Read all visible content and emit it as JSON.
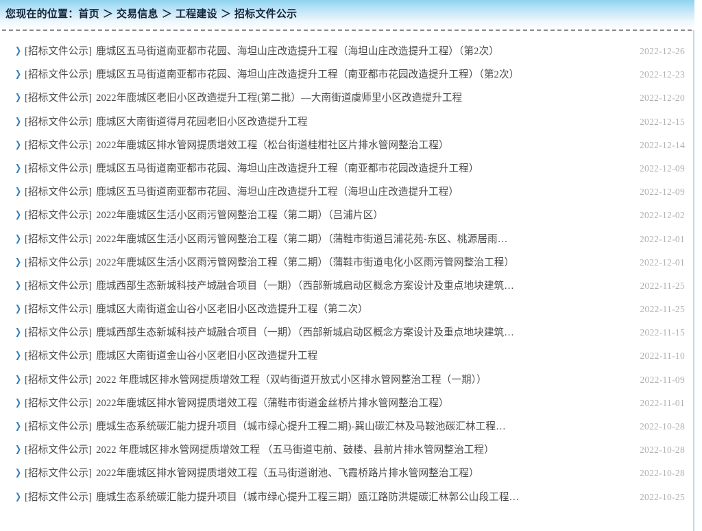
{
  "breadcrumb": {
    "label": "您现在的位置：",
    "separator": "＞",
    "items": [
      {
        "text": "首页"
      },
      {
        "text": "交易信息"
      },
      {
        "text": "工程建设"
      },
      {
        "text": "招标文件公示"
      }
    ]
  },
  "list": {
    "category_tag": "[招标文件公示]",
    "bullet_icon": "chevron-right-icon",
    "rows": [
      {
        "tag": "[招标文件公示]",
        "title": "鹿城区五马街道南亚都市花园、海坦山庄改造提升工程（海坦山庄改造提升工程）（第2次）",
        "date": "2022-12-26"
      },
      {
        "tag": "[招标文件公示]",
        "title": "鹿城区五马街道南亚都市花园、海坦山庄改造提升工程（南亚都市花园改造提升工程）（第2次）",
        "date": "2022-12-23"
      },
      {
        "tag": "[招标文件公示]",
        "title": "2022年鹿城区老旧小区改造提升工程(第二批）—大南街道虞师里小区改造提升工程",
        "date": "2022-12-20"
      },
      {
        "tag": "[招标文件公示]",
        "title": "鹿城区大南街道得月花园老旧小区改造提升工程",
        "date": "2022-12-15"
      },
      {
        "tag": "[招标文件公示]",
        "title": "2022年鹿城区排水管网提质增效工程（松台街道桂柑社区片排水管网整治工程）",
        "date": "2022-12-14"
      },
      {
        "tag": "[招标文件公示]",
        "title": "鹿城区五马街道南亚都市花园、海坦山庄改造提升工程（南亚都市花园改造提升工程）",
        "date": "2022-12-09"
      },
      {
        "tag": "[招标文件公示]",
        "title": "鹿城区五马街道南亚都市花园、海坦山庄改造提升工程（海坦山庄改造提升工程）",
        "date": "2022-12-09"
      },
      {
        "tag": "[招标文件公示]",
        "title": "2022年鹿城区生活小区雨污管网整治工程（第二期）（吕浦片区）",
        "date": "2022-12-02"
      },
      {
        "tag": "[招标文件公示]",
        "title": "2022年鹿城区生活小区雨污管网整治工程（第二期）（蒲鞋市街道吕浦花苑-东区、桃源居雨…",
        "date": "2022-12-01"
      },
      {
        "tag": "[招标文件公示]",
        "title": "2022年鹿城区生活小区雨污管网整治工程（第二期）（蒲鞋市街道电化小区雨污管网整治工程）",
        "date": "2022-12-01"
      },
      {
        "tag": "[招标文件公示]",
        "title": "鹿城西部生态新城科技产城融合项目（一期）（西部新城启动区概念方案设计及重点地块建筑…",
        "date": "2022-11-25"
      },
      {
        "tag": "[招标文件公示]",
        "title": "鹿城区大南街道金山谷小区老旧小区改造提升工程（第二次）",
        "date": "2022-11-25"
      },
      {
        "tag": "[招标文件公示]",
        "title": "鹿城西部生态新城科技产城融合项目（一期）（西部新城启动区概念方案设计及重点地块建筑…",
        "date": "2022-11-15"
      },
      {
        "tag": "[招标文件公示]",
        "title": "鹿城区大南街道金山谷小区老旧小区改造提升工程",
        "date": "2022-11-10"
      },
      {
        "tag": "[招标文件公示]",
        "title": "2022 年鹿城区排水管网提质增效工程（双屿街道开放式小区排水管网整治工程（一期））",
        "date": "2022-11-09"
      },
      {
        "tag": "[招标文件公示]",
        "title": "2022年鹿城区排水管网提质增效工程（蒲鞋市街道金丝桥片排水管网整治工程）",
        "date": "2022-11-01"
      },
      {
        "tag": "[招标文件公示]",
        "title": "鹿城生态系统碳汇能力提升项目（城市绿心提升工程二期)-巽山碳汇林及马鞍池碳汇林工程…",
        "date": "2022-10-28"
      },
      {
        "tag": "[招标文件公示]",
        "title": "2022 年鹿城区排水管网提质增效工程 （五马街道屯前、鼓楼、县前片排水管网整治工程）",
        "date": "2022-10-28"
      },
      {
        "tag": "[招标文件公示]",
        "title": "2022年鹿城区排水管网提质增效工程（五马街道谢池、飞霞桥路片排水管网整治工程）",
        "date": "2022-10-28"
      },
      {
        "tag": "[招标文件公示]",
        "title": "鹿城生态系统碳汇能力提升项目（城市绿心提升工程三期）瓯江路防洪堤碳汇林郭公山段工程…",
        "date": "2022-10-25"
      }
    ]
  },
  "colors": {
    "header_gradient_top": "#8ed3ef",
    "header_gradient_bottom": "#ffffff",
    "bullet": "#2f7fbf",
    "title_text": "#4a4a4a",
    "date_text": "#b0b0b0",
    "breadcrumb_text": "#16263a",
    "page_border": "#b9dff2",
    "divider": "#8a8a8a"
  }
}
